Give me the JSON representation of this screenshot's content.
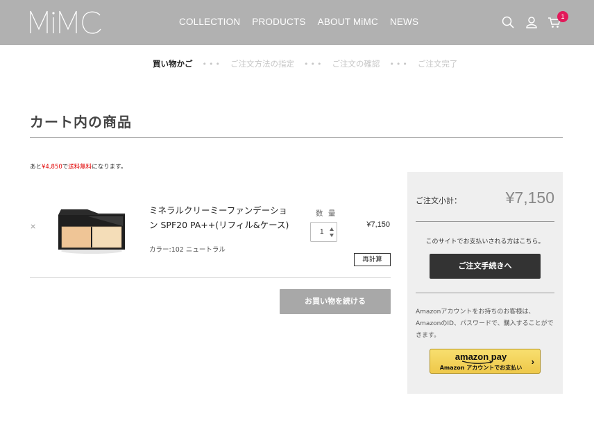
{
  "header": {
    "logo_text": "MiMC",
    "nav": [
      "COLLECTION",
      "PRODUCTS",
      "ABOUT MiMC",
      "NEWS"
    ],
    "cart_count": "1",
    "icons": [
      "search-icon",
      "user-icon",
      "cart-icon"
    ]
  },
  "steps": [
    "買い物かご",
    "ご注文方法の指定",
    "ご注文の確認",
    "ご注文完了"
  ],
  "steps_separator": "•••",
  "page_title": "カート内の商品",
  "free_shipping": {
    "prefix": "あと",
    "amount": "¥4,850",
    "middle": "で",
    "highlight": "送料無料",
    "suffix": "になります。"
  },
  "item": {
    "remove": "×",
    "name": "ミネラルクリーミーファンデーション SPF20 PA++(リフィル&ケース)",
    "color": "カラー:102 ニュートラル",
    "qty_label": "数 量",
    "qty_value": "1",
    "price": "¥7,150",
    "recalc_label": "再計算"
  },
  "continue_label": "お買い物を続ける",
  "summary": {
    "subtotal_label": "ご注文小計：",
    "subtotal_value": "¥7,150",
    "pay_note": "このサイトでお支払いされる方はこちら。",
    "checkout_label": "ご注文手続きへ",
    "amazon_note": "Amazonアカウントをお持ちのお客様は、AmazonのID、パスワードで、購入することができます。",
    "amazon_btn_line1": "amazon pay",
    "amazon_btn_line2": "Amazon アカウントでお支払い",
    "amazon_chevron": "›"
  },
  "colors": {
    "header_bg": "#b1b1b1",
    "badge": "#e2195a",
    "highlight_red": "#e00000",
    "checkout_bg": "#333333",
    "continue_bg": "#a8a8a8",
    "panel_bg": "#efefef",
    "amazon_yellow": "#f3d35b"
  }
}
